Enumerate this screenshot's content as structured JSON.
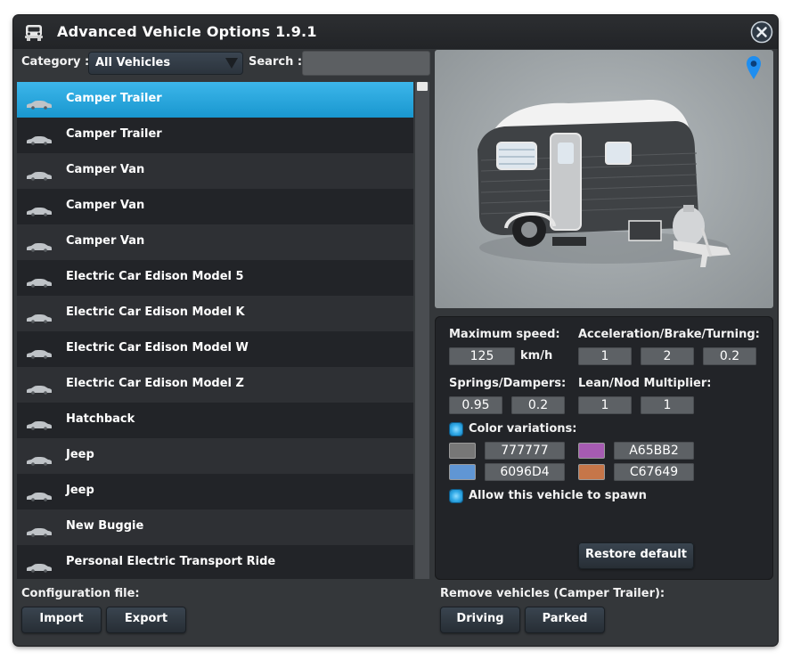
{
  "window": {
    "title": "Advanced Vehicle Options 1.9.1"
  },
  "filter": {
    "category_label": "Category :",
    "category_value": "All Vehicles",
    "search_label": "Search :",
    "search_value": ""
  },
  "vehicles": [
    {
      "name": "Camper Trailer",
      "selected": true
    },
    {
      "name": "Camper Trailer",
      "selected": false
    },
    {
      "name": "Camper Van",
      "selected": false
    },
    {
      "name": "Camper Van",
      "selected": false
    },
    {
      "name": "Camper Van",
      "selected": false
    },
    {
      "name": "Electric Car Edison Model 5",
      "selected": false
    },
    {
      "name": "Electric Car Edison Model K",
      "selected": false
    },
    {
      "name": "Electric Car Edison Model W",
      "selected": false
    },
    {
      "name": "Electric Car Edison Model Z",
      "selected": false
    },
    {
      "name": "Hatchback",
      "selected": false
    },
    {
      "name": "Jeep",
      "selected": false
    },
    {
      "name": "Jeep",
      "selected": false
    },
    {
      "name": "New Buggie",
      "selected": false
    },
    {
      "name": "Personal Electric Transport Ride",
      "selected": false
    }
  ],
  "options": {
    "max_speed_label": "Maximum speed:",
    "max_speed": "125",
    "speed_unit": "km/h",
    "accel_label": "Acceleration/Brake/Turning:",
    "acceleration": "1",
    "brake": "2",
    "turning": "0.2",
    "springs_label": "Springs/Dampers:",
    "springs": "0.95",
    "dampers": "0.2",
    "lean_label": "Lean/Nod Multiplier:",
    "lean": "1",
    "nod": "1",
    "color_variations_label": "Color variations:",
    "color_variations_checked": true,
    "colors": [
      {
        "hex": "777777",
        "swatch": "#777777"
      },
      {
        "hex": "A65BB2",
        "swatch": "#A65BB2"
      },
      {
        "hex": "6096D4",
        "swatch": "#6096D4"
      },
      {
        "hex": "C67649",
        "swatch": "#C67649"
      }
    ],
    "allow_spawn_label": "Allow this vehicle to spawn",
    "allow_spawn_checked": true,
    "restore_label": "Restore default"
  },
  "footer": {
    "config_label": "Configuration file:",
    "import_label": "Import",
    "export_label": "Export",
    "remove_label": "Remove vehicles (Camper Trailer):",
    "driving_label": "Driving",
    "parked_label": "Parked"
  },
  "theme": {
    "accent": "#2ea9e0",
    "window_bg": "#34373a",
    "panel_bg": "#222428"
  }
}
